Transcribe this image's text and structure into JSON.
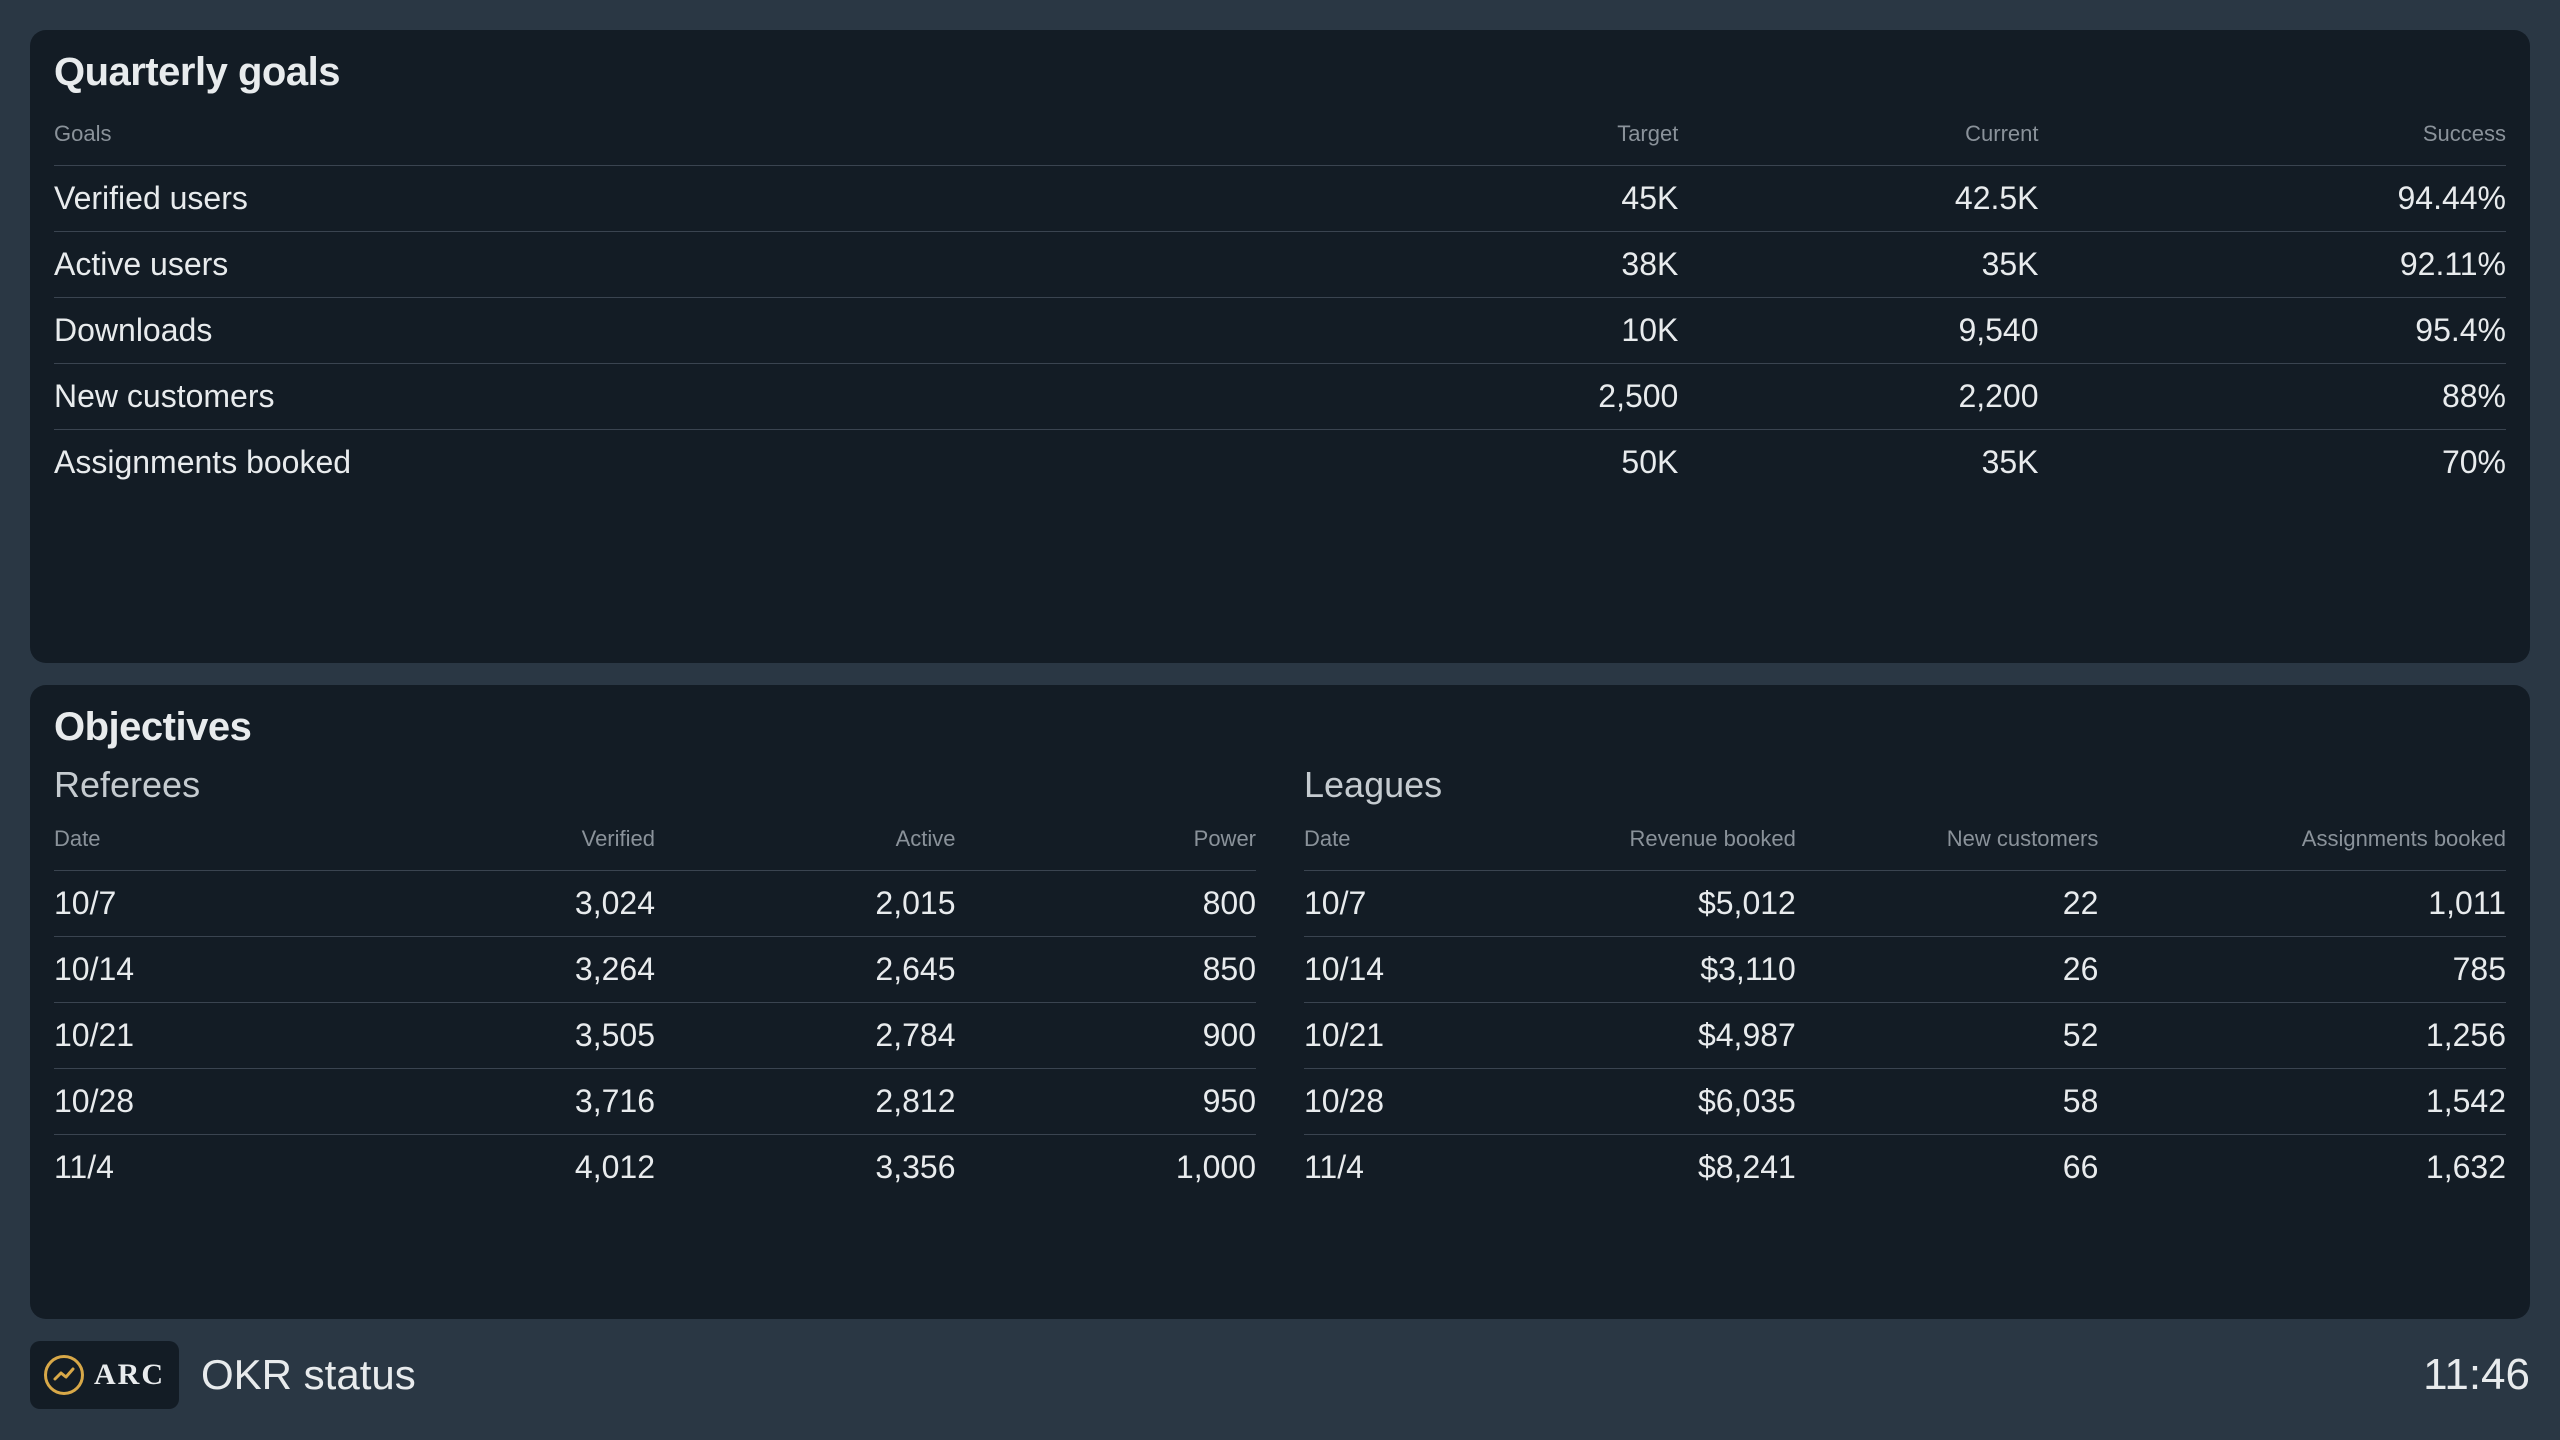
{
  "quarterly": {
    "title": "Quarterly goals",
    "headers": [
      "Goals",
      "Target",
      "Current",
      "Success"
    ],
    "rows": [
      {
        "goal": "Verified users",
        "target": "45K",
        "current": "42.5K",
        "success": "94.44%"
      },
      {
        "goal": "Active users",
        "target": "38K",
        "current": "35K",
        "success": "92.11%"
      },
      {
        "goal": "Downloads",
        "target": "10K",
        "current": "9,540",
        "success": "95.4%"
      },
      {
        "goal": "New customers",
        "target": "2,500",
        "current": "2,200",
        "success": "88%"
      },
      {
        "goal": "Assignments booked",
        "target": "50K",
        "current": "35K",
        "success": "70%"
      }
    ]
  },
  "objectives": {
    "title": "Objectives",
    "referees": {
      "title": "Referees",
      "headers": [
        "Date",
        "Verified",
        "Active",
        "Power"
      ],
      "rows": [
        {
          "date": "10/7",
          "verified": "3,024",
          "active": "2,015",
          "power": "800"
        },
        {
          "date": "10/14",
          "verified": "3,264",
          "active": "2,645",
          "power": "850"
        },
        {
          "date": "10/21",
          "verified": "3,505",
          "active": "2,784",
          "power": "900"
        },
        {
          "date": "10/28",
          "verified": "3,716",
          "active": "2,812",
          "power": "950"
        },
        {
          "date": "11/4",
          "verified": "4,012",
          "active": "3,356",
          "power": "1,000"
        }
      ]
    },
    "leagues": {
      "title": "Leagues",
      "headers": [
        "Date",
        "Revenue booked",
        "New customers",
        "Assignments booked"
      ],
      "rows": [
        {
          "date": "10/7",
          "revenue": "$5,012",
          "new_customers": "22",
          "assignments": "1,011"
        },
        {
          "date": "10/14",
          "revenue": "$3,110",
          "new_customers": "26",
          "assignments": "785"
        },
        {
          "date": "10/21",
          "revenue": "$4,987",
          "new_customers": "52",
          "assignments": "1,256"
        },
        {
          "date": "10/28",
          "revenue": "$6,035",
          "new_customers": "58",
          "assignments": "1,542"
        },
        {
          "date": "11/4",
          "revenue": "$8,241",
          "new_customers": "66",
          "assignments": "1,632"
        }
      ]
    }
  },
  "footer": {
    "logo_text": "ARC",
    "title": "OKR status",
    "time": "11:46"
  }
}
